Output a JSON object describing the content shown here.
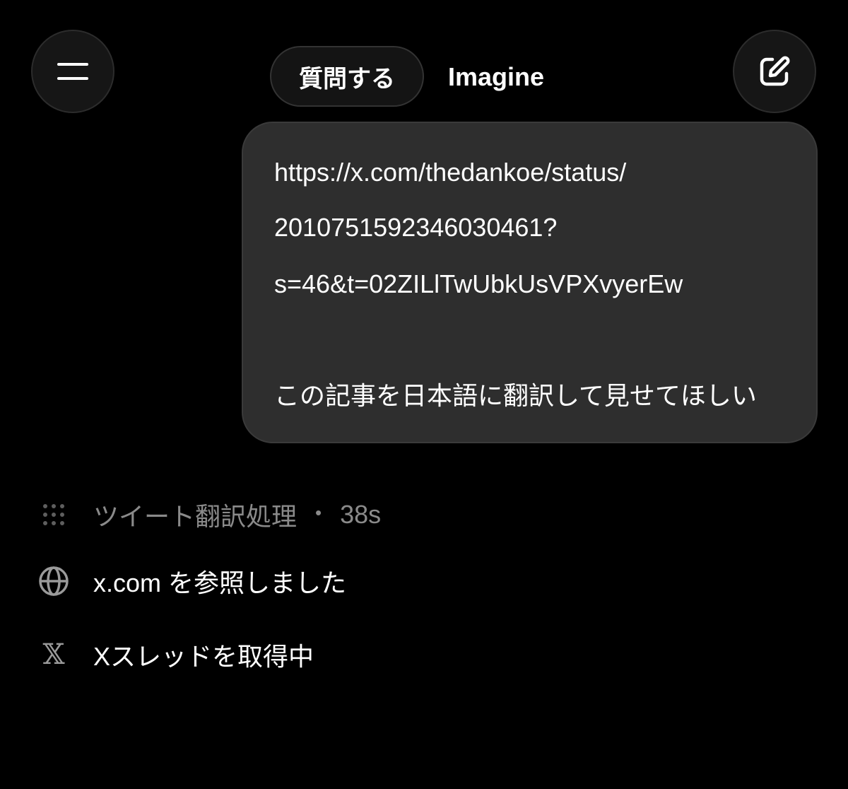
{
  "header": {
    "menu_icon": "hamburger-menu-icon",
    "tabs": [
      {
        "label": "質問する",
        "active": true
      },
      {
        "label": "Imagine",
        "active": false
      }
    ],
    "compose_icon": "edit-compose-icon"
  },
  "message": {
    "lines": [
      "https://x.com/thedankoe/status/",
      "2010751592346030461?",
      "s=46&t=02ZILlTwUbkUsVPXvyerEw",
      "この記事を日本語に翻訳して見せてほしい"
    ]
  },
  "status": {
    "thinking": {
      "icon": "dot-grid-icon",
      "label": "ツイート翻訳処理",
      "separator": "•",
      "duration": "38s"
    },
    "browsed": {
      "icon": "globe-icon",
      "label": "x.com を参照しました"
    },
    "fetching": {
      "icon": "x-logo-icon",
      "glyph": "𝕏",
      "label": "Xスレッドを取得中"
    }
  },
  "colors": {
    "background": "#000000",
    "bubble": "#2e2e2e",
    "muted_text": "#8a8a8a"
  }
}
